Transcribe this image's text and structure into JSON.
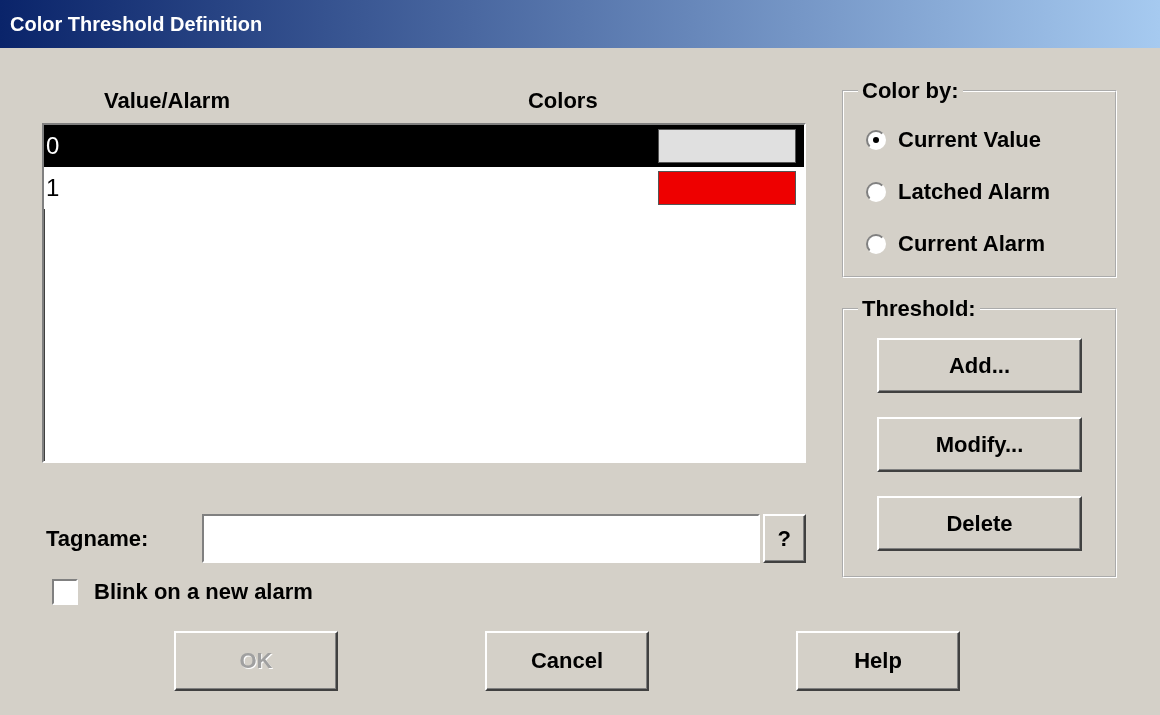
{
  "window": {
    "title": "Color Threshold Definition"
  },
  "list": {
    "columns": [
      "Value/Alarm",
      "Colors"
    ],
    "rows": [
      {
        "value": "0",
        "color": "#e0e0e0",
        "selected": true
      },
      {
        "value": "1",
        "color": "#ee0000",
        "selected": false
      }
    ]
  },
  "color_by": {
    "label": "Color by:",
    "options": [
      {
        "label": "Current Value",
        "selected": true
      },
      {
        "label": "Latched Alarm",
        "selected": false
      },
      {
        "label": "Current Alarm",
        "selected": false
      }
    ]
  },
  "threshold": {
    "label": "Threshold:",
    "buttons": [
      "Add...",
      "Modify...",
      "Delete"
    ]
  },
  "tagname": {
    "label": "Tagname:",
    "browse": "?"
  },
  "blink": {
    "label": "Blink on a new alarm",
    "checked": false
  },
  "buttons": [
    {
      "label": "OK",
      "disabled": true
    },
    {
      "label": "Cancel",
      "disabled": false
    },
    {
      "label": "Help",
      "disabled": false
    }
  ]
}
